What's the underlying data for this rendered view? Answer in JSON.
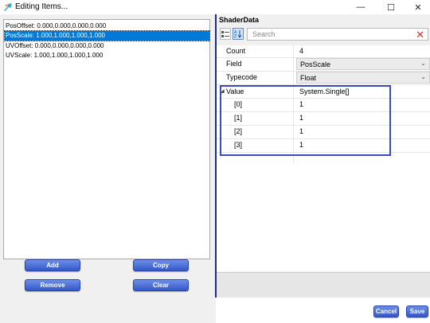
{
  "window": {
    "title": "Editing Items...",
    "controls": {
      "minimize": "—",
      "maximize": "☐",
      "close": "✕"
    }
  },
  "list": {
    "items": [
      {
        "label": "PosOffset:  0.000,0.000,0.000,0.000",
        "selected": false
      },
      {
        "label": "PosScale:  1.000,1.000,1.000,1.000",
        "selected": true
      },
      {
        "label": "UVOffset:  0.000,0.000,0.000,0.000",
        "selected": false
      },
      {
        "label": "UVScale:  1.000,1.000,1.000,1.000",
        "selected": false
      }
    ]
  },
  "buttons": {
    "add": "Add",
    "copy": "Copy",
    "remove": "Remove",
    "clear": "Clear",
    "cancel": "Cancel",
    "save": "Save",
    "color": "#4a6fd8"
  },
  "property_grid": {
    "header": "ShaderData",
    "search_placeholder": "Search",
    "rows": {
      "count": {
        "name": "Count",
        "value": "4"
      },
      "field": {
        "name": "Field",
        "value": "PosScale"
      },
      "typecode": {
        "name": "Typecode",
        "value": "Float"
      },
      "value": {
        "name": "Value",
        "value": "System.Single[]"
      },
      "elements": [
        {
          "name": "[0]",
          "value": "1"
        },
        {
          "name": "[1]",
          "value": "1"
        },
        {
          "name": "[2]",
          "value": "1"
        },
        {
          "name": "[3]",
          "value": "1"
        }
      ]
    }
  },
  "colors": {
    "selection": "#0078d7",
    "divider": "#1b2b8a",
    "highlight_box": "#3b4bb8"
  }
}
